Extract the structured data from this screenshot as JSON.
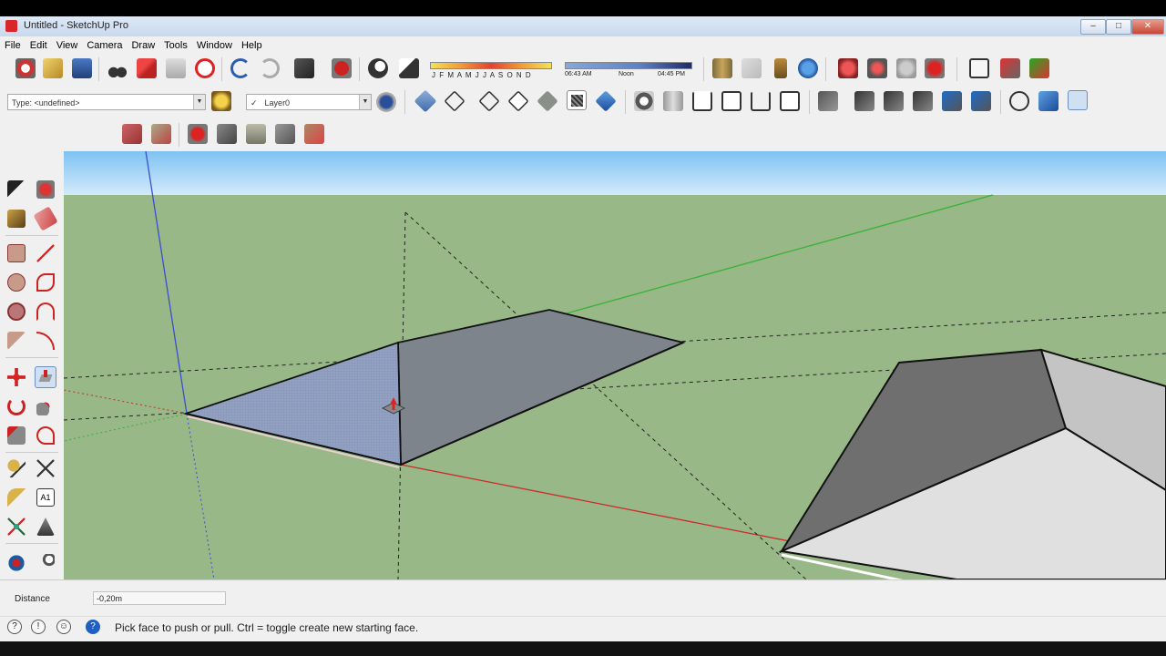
{
  "window": {
    "title": "Untitled - SketchUp Pro",
    "controls": {
      "minimize": "–",
      "maximize": "□",
      "close": "✕"
    }
  },
  "menu": [
    "File",
    "Edit",
    "View",
    "Camera",
    "Draw",
    "Tools",
    "Window",
    "Help"
  ],
  "shadow_toolbar": {
    "months": "J F M A M J J A S O N D",
    "time_start": "06:43 AM",
    "time_noon": "Noon",
    "time_end": "04:45 PM"
  },
  "entity_info": {
    "type_label": "Type: <undefined>",
    "layer_check": "✓",
    "layer_name": "Layer0"
  },
  "measurements": {
    "label": "Distance",
    "value": "-0,20m"
  },
  "status": {
    "message": "Pick face to push or pull.  Ctrl = toggle create new starting face.",
    "icons": [
      "geolocation-icon",
      "credits-icon",
      "user-icon",
      "help-icon"
    ]
  },
  "colors": {
    "sky_top": "#7ec2f2",
    "sky_bottom": "#d6ecfb",
    "ground": "#98b887",
    "face_selected": "#8f9fbf",
    "face_top": "#7e848c",
    "axis_red": "#cc2a2a",
    "axis_green": "#36b236",
    "axis_blue": "#3a4fd0"
  }
}
